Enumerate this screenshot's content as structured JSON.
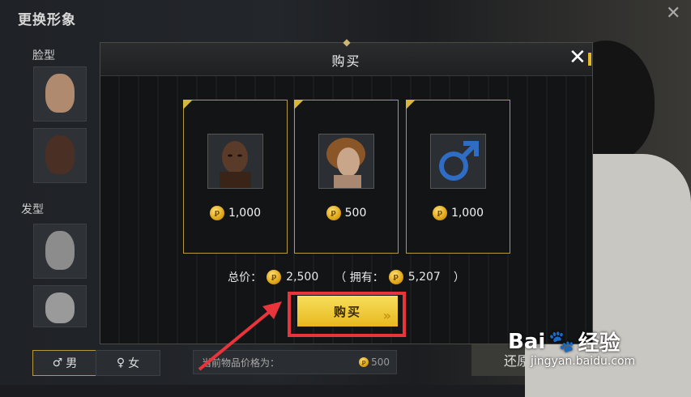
{
  "background": {
    "title": "更换形象",
    "face_label": "脸型",
    "hair_label": "发型",
    "gender_male": "男",
    "gender_female": "女",
    "male_symbol": "♂",
    "female_symbol": "♀",
    "price_label": "当前物品价格为：",
    "price_value": "500",
    "restore_label": "还原"
  },
  "modal": {
    "title": "购买",
    "close_symbol": "✕",
    "items": [
      {
        "name": "face-item",
        "price": "1,000",
        "icon": "face-portrait"
      },
      {
        "name": "hair-item",
        "price": "500",
        "icon": "curly-hair-portrait"
      },
      {
        "name": "gender-item",
        "price": "1,000",
        "icon": "male-symbol-icon",
        "symbol": "♂"
      }
    ],
    "total_label": "总价：",
    "total_value": "2,500",
    "owned_open": "（ 拥有：",
    "owned_value": "5,207",
    "owned_close": "）",
    "buy_label": "购买",
    "buy_chevron": "»"
  },
  "coin_symbol": "ꝑ",
  "watermark": {
    "logo": "Bai",
    "logo_suffix": "经验",
    "url": "jingyan.baidu.com"
  },
  "colors": {
    "gold": "#e7b81f",
    "highlight_red": "#e8343a",
    "card_border": "#b49a3c"
  }
}
